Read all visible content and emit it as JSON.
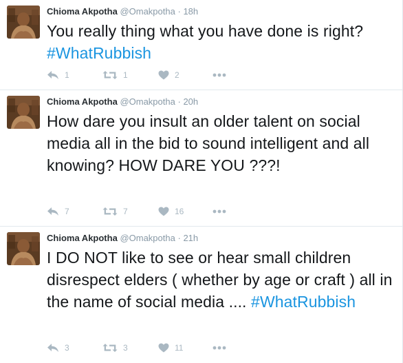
{
  "tweets": [
    {
      "name": "Chioma Akpotha",
      "handle": "@Omakpotha",
      "separator": "·",
      "time": "18h",
      "text": "You really thing what you have done is right? ",
      "hashtag": "#WhatRubbish",
      "text_after": "",
      "reply_count": "1",
      "retweet_count": "1",
      "like_count": "2"
    },
    {
      "name": "Chioma Akpotha",
      "handle": "@Omakpotha",
      "separator": "·",
      "time": "20h",
      "text": "How dare you insult an older talent on social media all in the bid to sound intelligent and all knowing? HOW DARE YOU ???!",
      "hashtag": "",
      "text_after": "",
      "reply_count": "7",
      "retweet_count": "7",
      "like_count": "16"
    },
    {
      "name": "Chioma Akpotha",
      "handle": "@Omakpotha",
      "separator": "·",
      "time": "21h",
      "text": "I DO NOT like to see or hear small children disrespect elders ( whether by age or craft ) all in the name of social media .... ",
      "hashtag": "#WhatRubbish",
      "text_after": "",
      "reply_count": "3",
      "retweet_count": "3",
      "like_count": "11"
    }
  ],
  "icons": {
    "reply": "reply-icon",
    "retweet": "retweet-icon",
    "like": "heart-icon",
    "more": "more-dots-icon"
  },
  "colors": {
    "hashtag": "#1b95e0",
    "action_icon": "#aab8c2",
    "meta": "#8899a6",
    "divider": "#e1e8ed"
  }
}
